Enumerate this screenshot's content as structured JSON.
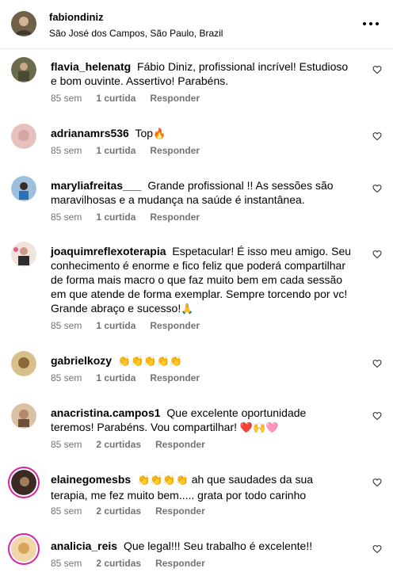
{
  "post": {
    "username": "fabiondiniz",
    "location": "São José dos Campos, São Paulo, Brazil",
    "avatar_color": "#6f6048"
  },
  "labels": {
    "reply": "Responder"
  },
  "comments": [
    {
      "username": "flavia_helenatg",
      "text": "Fábio Diniz, profissional incrível! Estudioso e bom ouvinte. Assertivo! Parabéns.",
      "emoji": "",
      "time": "85 sem",
      "likes": "1 curtida",
      "avatar_color": "#6b6a4a"
    },
    {
      "username": "adrianamrs536",
      "text": "Top",
      "emoji": "🔥",
      "time": "85 sem",
      "likes": "1 curtida",
      "avatar_color": "#d7a6a4"
    },
    {
      "username": "marylia​freitas___",
      "text": "Grande profissional !! As sessões são maravilhosas e a mudança na saúde é instantânea.",
      "emoji": "",
      "time": "85 sem",
      "likes": "1 curtida",
      "avatar_color": "#6f8fb4"
    },
    {
      "username": "joaquimreflexoterapia",
      "text": "Espetacular! É isso meu amigo. Seu conhecimento é enorme e fico feliz que poderá compartilhar de forma mais macro o que faz muito bem em cada sessão em que atende de forma exemplar. Sempre torcendo por vc! Grande abraço e sucesso!",
      "emoji": "🙏",
      "time": "85 sem",
      "likes": "1 curtida",
      "avatar_color": "#c99a86"
    },
    {
      "username": "gabrielkozy",
      "text": "",
      "emoji": "👏👏👏👏👏",
      "time": "85 sem",
      "likes": "1 curtida",
      "avatar_color": "#8a6a3b"
    },
    {
      "username": "anacristina.campos1",
      "text": "Que excelente oportunidade teremos! Parabéns. Vou compartilhar!",
      "emoji": "❤️🙌🩷",
      "time": "85 sem",
      "likes": "2 curtidas",
      "avatar_color": "#b48a6c"
    },
    {
      "username": "elainegomesbs",
      "text": "ah que saudades da sua terapia, me fez muito bem..... grata por todo carinho",
      "emoji": "👏👏👏👏",
      "time": "85 sem",
      "likes": "2 curtidas",
      "avatar_color": "#a07b5e",
      "emoji_first": true
    },
    {
      "username": "analicia_reis",
      "text": "Que legal!!! Seu trabalho é excelente!!",
      "emoji": "",
      "time": "85 sem",
      "likes": "2 curtidas",
      "avatar_color": "#d9a35a"
    }
  ]
}
